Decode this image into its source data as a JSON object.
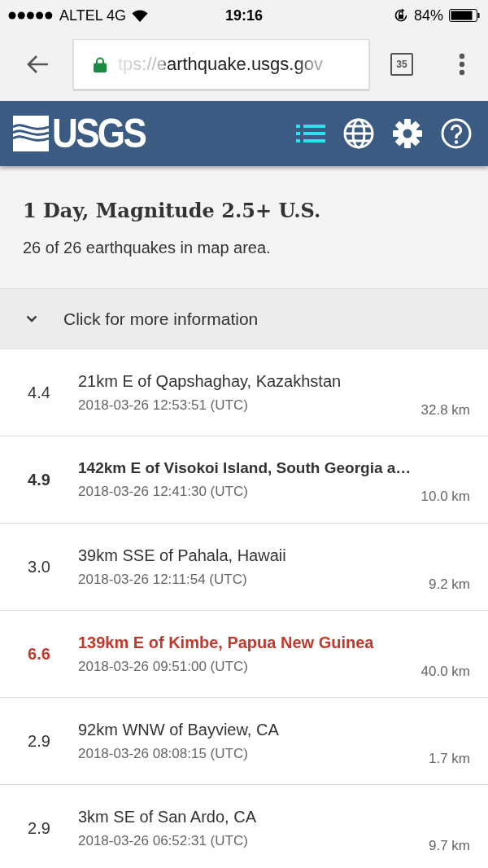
{
  "status_bar": {
    "carrier": "ALTEL 4G",
    "time": "19:16",
    "battery": "84%"
  },
  "browser": {
    "url": "tps://earthquake.usgs.gov",
    "tab_count": "35"
  },
  "header": {
    "logo": "USGS"
  },
  "summary": {
    "title": "1 Day, Magnitude 2.5+ U.S.",
    "subtitle": "26 of 26 earthquakes in map area."
  },
  "info_toggle": {
    "label": "Click for more information",
    "expanded": false
  },
  "earthquakes": [
    {
      "kind": "normal",
      "magnitude": "4.4",
      "place": "21km E of Qapshaghay, Kazakhstan",
      "time": "2018-03-26 12:53:51 (UTC)",
      "depth": "32.8 km"
    },
    {
      "kind": "significant",
      "magnitude": "4.9",
      "place": "142km E of Visokoi Island, South Georgia a…",
      "time": "2018-03-26 12:41:30 (UTC)",
      "depth": "10.0 km"
    },
    {
      "kind": "normal",
      "magnitude": "3.0",
      "place": "39km SSE of Pahala, Hawaii",
      "time": "2018-03-26 12:11:54 (UTC)",
      "depth": "9.2 km"
    },
    {
      "kind": "major",
      "magnitude": "6.6",
      "place": "139km E of Kimbe, Papua New Guinea",
      "time": "2018-03-26 09:51:00 (UTC)",
      "depth": "40.0 km"
    },
    {
      "kind": "normal",
      "magnitude": "2.9",
      "place": "92km WNW of Bayview, CA",
      "time": "2018-03-26 08:08:15 (UTC)",
      "depth": "1.7 km"
    },
    {
      "kind": "normal",
      "magnitude": "2.9",
      "place": "3km SE of San Ardo, CA",
      "time": "2018-03-26 06:52:31 (UTC)",
      "depth": "9.7 km"
    }
  ]
}
